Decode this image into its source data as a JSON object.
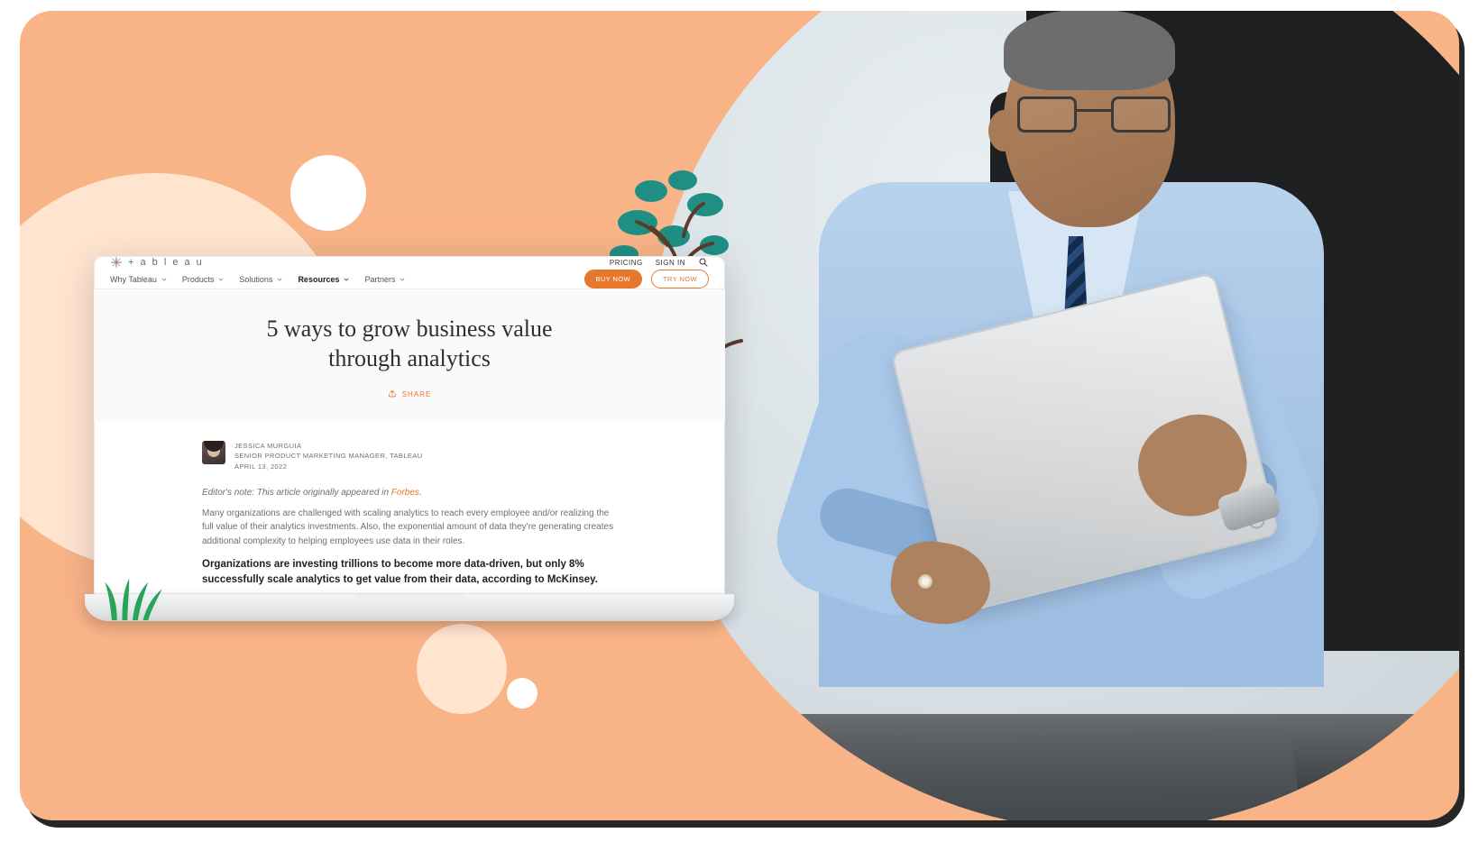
{
  "brand": {
    "name": "+ a b l e a u"
  },
  "toplinks": {
    "pricing": "PRICING",
    "signin": "SIGN IN"
  },
  "nav": {
    "items": [
      {
        "label": "Why Tableau",
        "active": false,
        "chevron": true
      },
      {
        "label": "Products",
        "active": false,
        "chevron": true
      },
      {
        "label": "Solutions",
        "active": false,
        "chevron": true
      },
      {
        "label": "Resources",
        "active": true,
        "chevron": true
      },
      {
        "label": "Partners",
        "active": false,
        "chevron": true
      }
    ]
  },
  "cta": {
    "buy": "BUY NOW",
    "try": "TRY NOW"
  },
  "hero": {
    "title_line1": "5 ways to grow business value",
    "title_line2": "through analytics",
    "share": "SHARE"
  },
  "byline": {
    "name": "JESSICA MURGUIA",
    "role": "SENIOR PRODUCT MARKETING MANAGER, TABLEAU",
    "date": "APRIL 13, 2022"
  },
  "article": {
    "note_prefix": "Editor's note: This article originally appeared in ",
    "note_link": "Forbes",
    "note_suffix": ".",
    "para1": "Many organizations are challenged with scaling analytics to reach every employee and/or realizing the full value of their analytics investments. Also, the exponential amount of data they're generating creates additional complexity to helping employees use data in their roles.",
    "headline": "Organizations are investing trillions to become more data-driven, but only 8% successfully scale analytics to get value from their data, according to McKinsey."
  },
  "colors": {
    "accent": "#e8762c",
    "peach": "#f8b387",
    "teal": "#1f8f84"
  }
}
